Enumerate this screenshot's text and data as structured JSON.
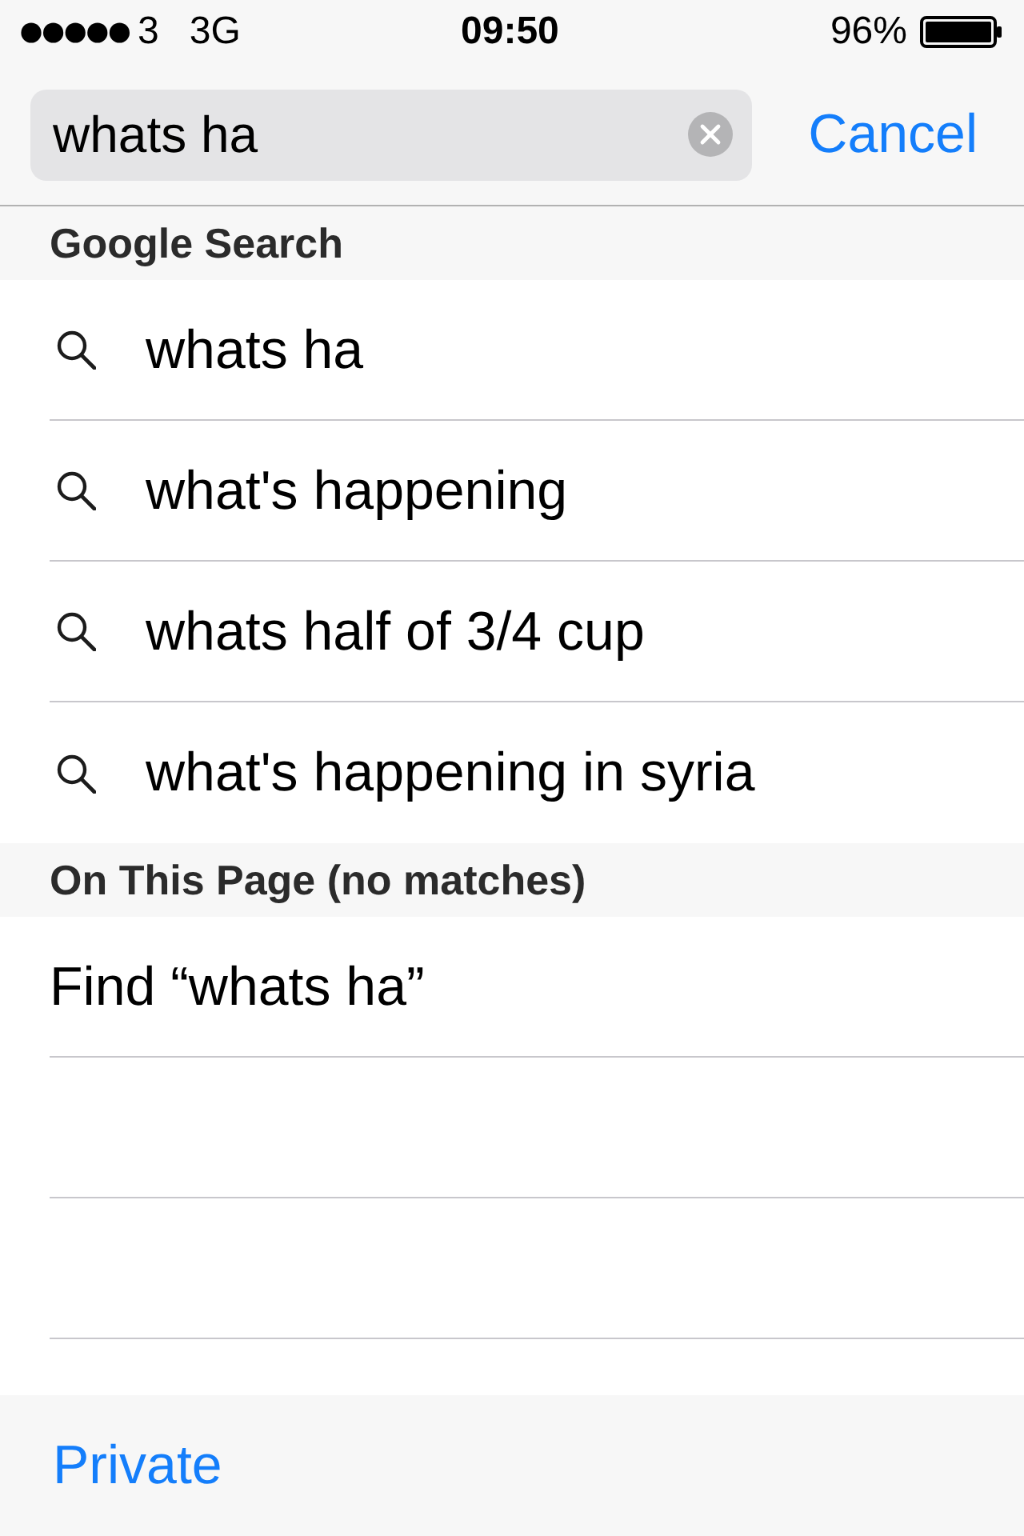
{
  "status_bar": {
    "carrier": "3",
    "network": "3G",
    "time": "09:50",
    "battery": "96%"
  },
  "search": {
    "value": "whats ha",
    "cancel": "Cancel"
  },
  "sections": [
    {
      "title": "Google Search",
      "items": [
        {
          "kind": "suggestion",
          "text": "whats ha"
        },
        {
          "kind": "suggestion",
          "text": "what's happening"
        },
        {
          "kind": "suggestion",
          "text": "whats half of 3/4 cup"
        },
        {
          "kind": "suggestion",
          "text": "what's happening in syria"
        }
      ]
    },
    {
      "title": "On This Page (no matches)",
      "items": [
        {
          "kind": "find",
          "text": "Find “whats ha”"
        }
      ]
    }
  ],
  "toolbar": {
    "private": "Private"
  }
}
